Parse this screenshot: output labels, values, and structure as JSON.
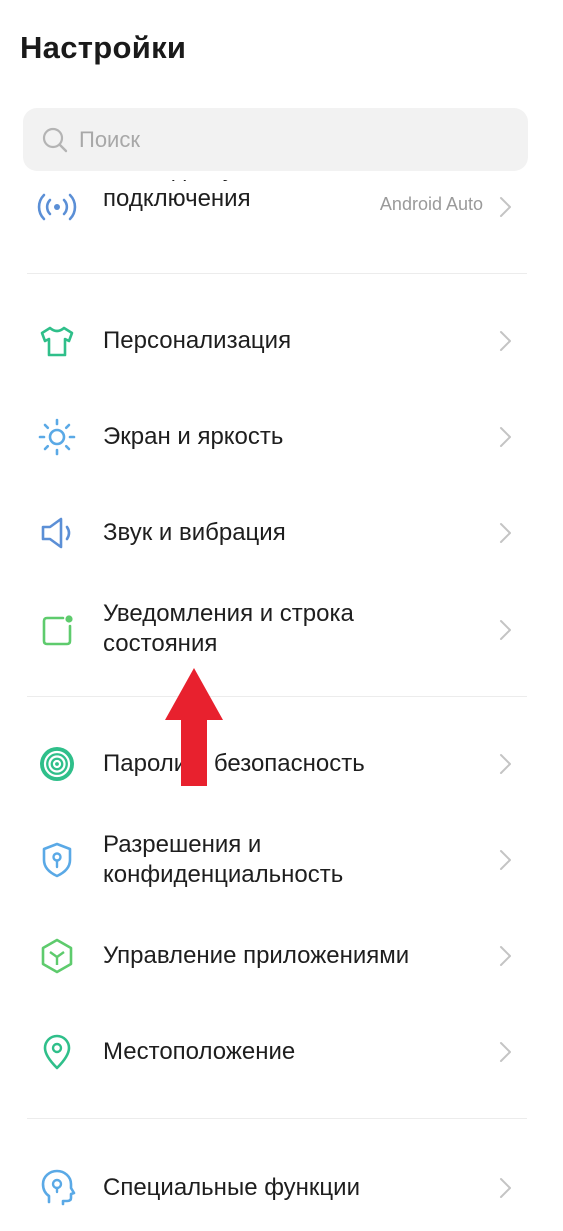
{
  "header": {
    "title": "Настройки"
  },
  "search": {
    "placeholder": "Поиск"
  },
  "sections": [
    {
      "items": [
        {
          "label": "Точка доступа и подключения",
          "value": "Android Auto",
          "icon": "hotspot-icon"
        }
      ]
    },
    {
      "items": [
        {
          "label": "Персонализация",
          "icon": "tshirt-icon"
        },
        {
          "label": "Экран и яркость",
          "icon": "sun-icon"
        },
        {
          "label": "Звук и вибрация",
          "icon": "speaker-icon"
        },
        {
          "label": "Уведомления и строка состояния",
          "icon": "notification-icon"
        }
      ]
    },
    {
      "items": [
        {
          "label": "Пароли и безопасность",
          "icon": "fingerprint-icon"
        },
        {
          "label": "Разрешения и конфиденциальность",
          "icon": "shield-keyhole-icon"
        },
        {
          "label": "Управление приложениями",
          "icon": "cube-icon"
        },
        {
          "label": "Местоположение",
          "icon": "location-pin-icon"
        }
      ]
    },
    {
      "items": [
        {
          "label": "Специальные функции",
          "icon": "accessibility-head-icon"
        }
      ]
    }
  ],
  "overlay": {
    "annotation": "red-arrow-up-icon"
  },
  "colors": {
    "blue": "#5b8fd6",
    "green": "#2fbf8a",
    "lightGreen": "#5ecb6d",
    "red": "#e8212e",
    "chevron": "#c4c4c4"
  }
}
